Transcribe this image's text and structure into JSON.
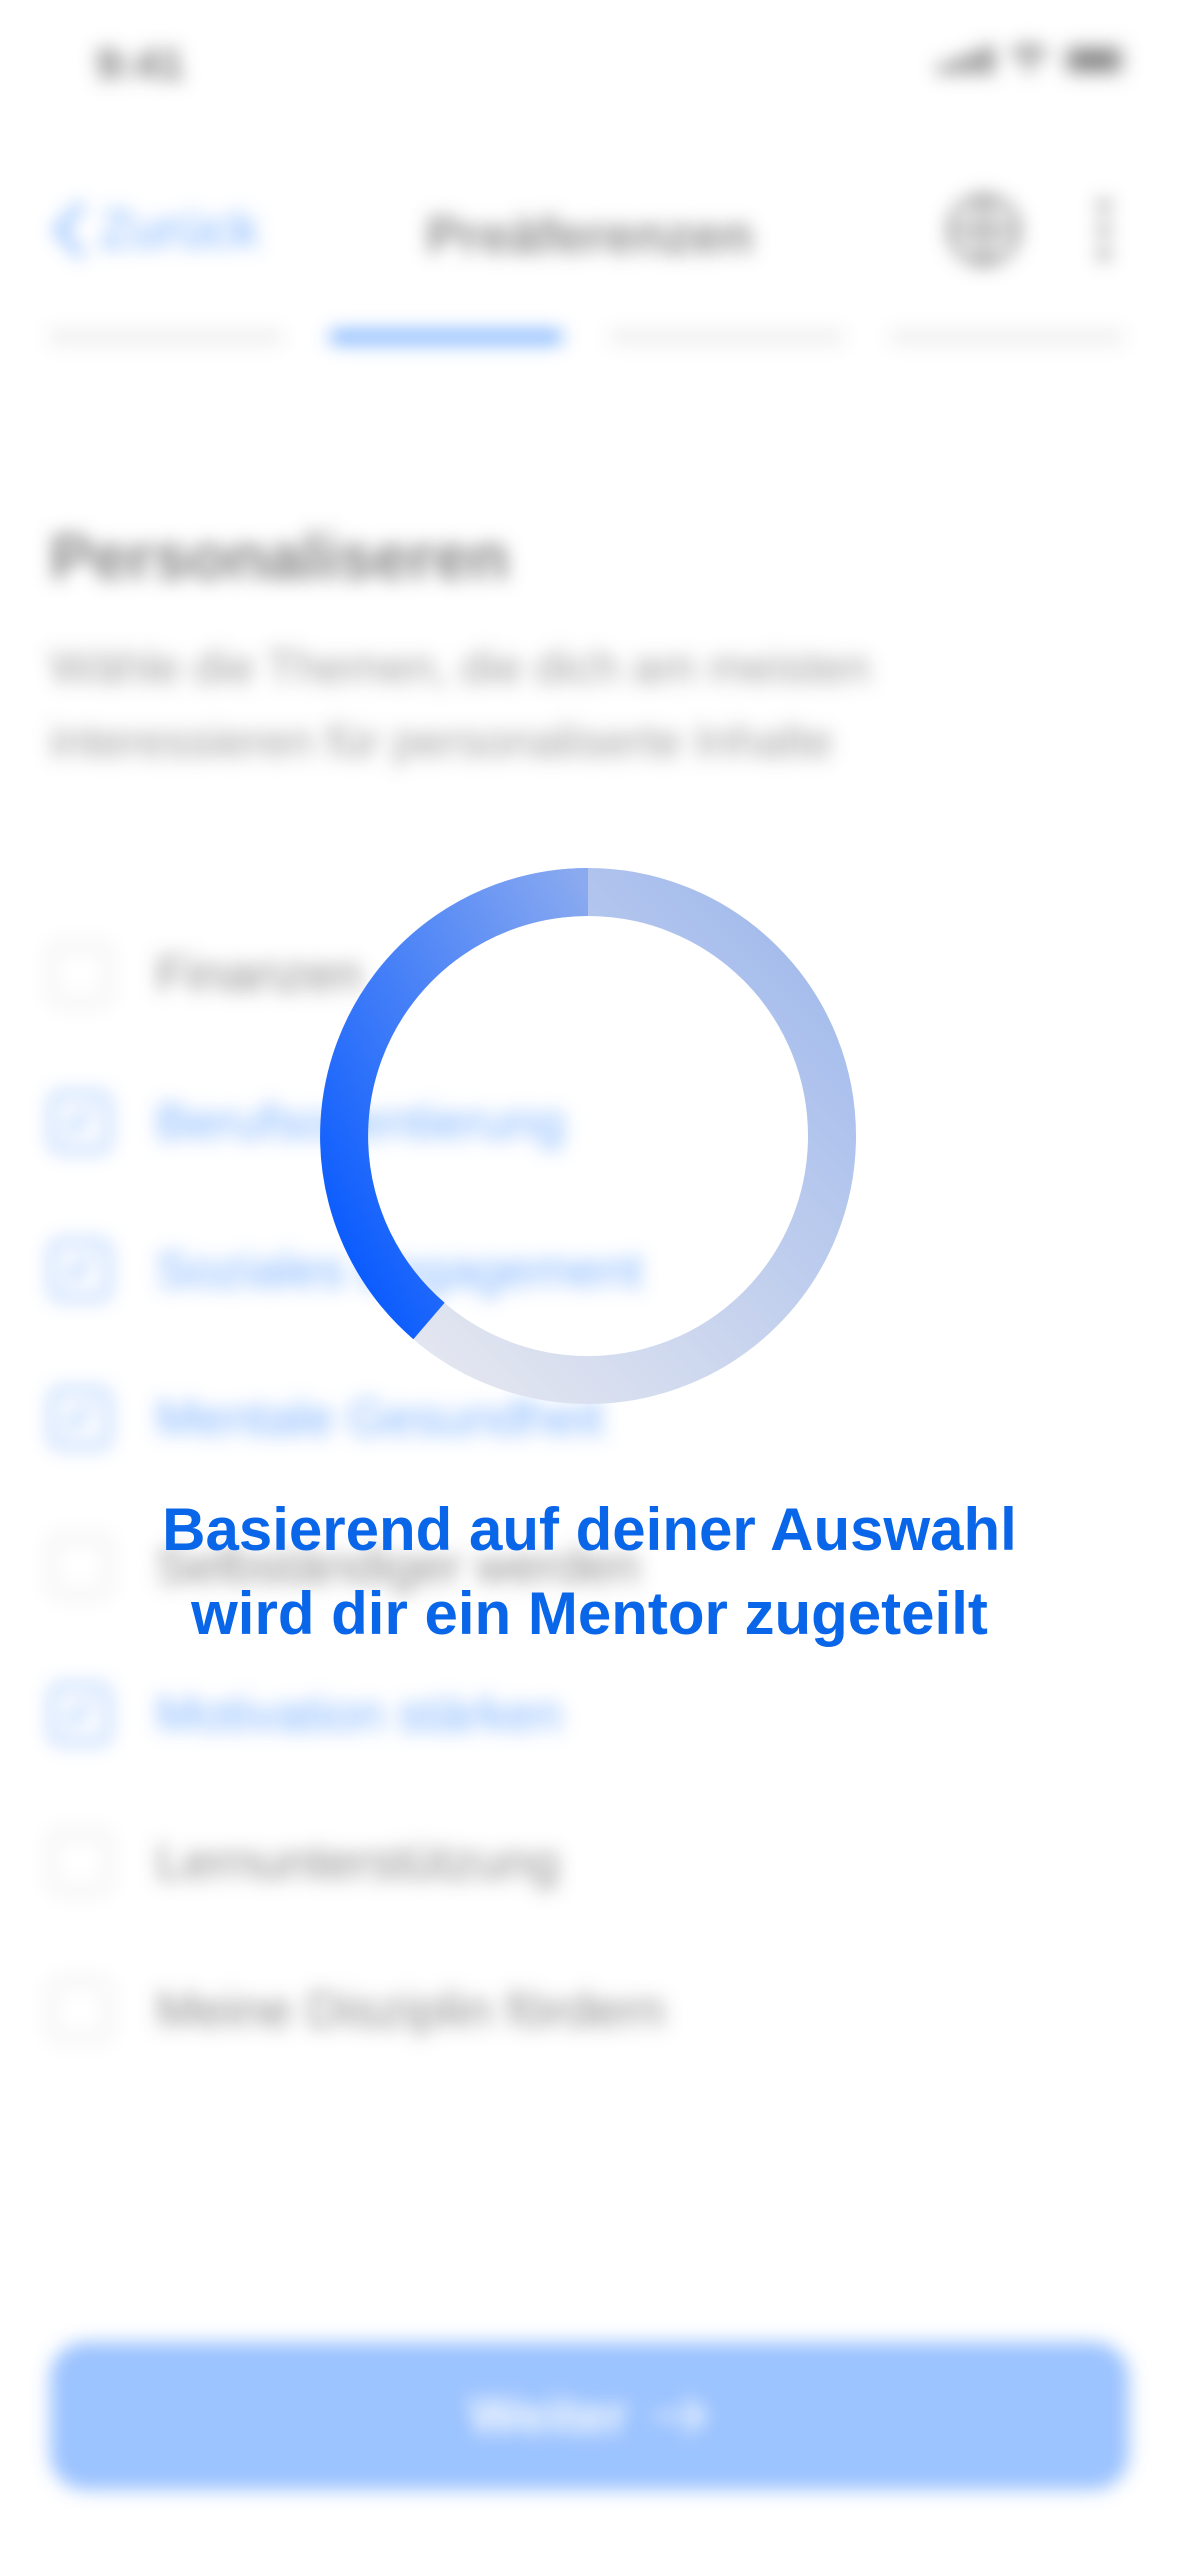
{
  "status_bar": {
    "time": "9:41"
  },
  "nav": {
    "back_label": "Zurück",
    "title": "Preäferenzen",
    "icons": [
      "globe-icon",
      "more-vertical-icon"
    ]
  },
  "progress": {
    "total_steps": 4,
    "current_step": 2
  },
  "content": {
    "heading": "Personaliseren",
    "subtitle": "Wähle die Themen, die dich am meisten interessieren für personaliserte Inhalte",
    "options": [
      {
        "label": "Finanzen",
        "checked": false
      },
      {
        "label": "Berufsorientierung",
        "checked": true
      },
      {
        "label": "Soziales Engagement",
        "checked": true
      },
      {
        "label": "Mentale Gesundheit",
        "checked": true
      },
      {
        "label": "Selbständiger werden",
        "checked": false
      },
      {
        "label": "Motivation stärken",
        "checked": true
      },
      {
        "label": "Lernunterstützung",
        "checked": false
      },
      {
        "label": "Meine Disziplin fördern",
        "checked": false
      }
    ]
  },
  "footer": {
    "next_label": "Weiter"
  },
  "overlay": {
    "line1": "Basierend auf deiner Auswahl",
    "line2": "wird dir ein Mentor zugeteilt"
  },
  "colors": {
    "accent": "#1677ff",
    "overlay_text": "#0a66e8"
  }
}
